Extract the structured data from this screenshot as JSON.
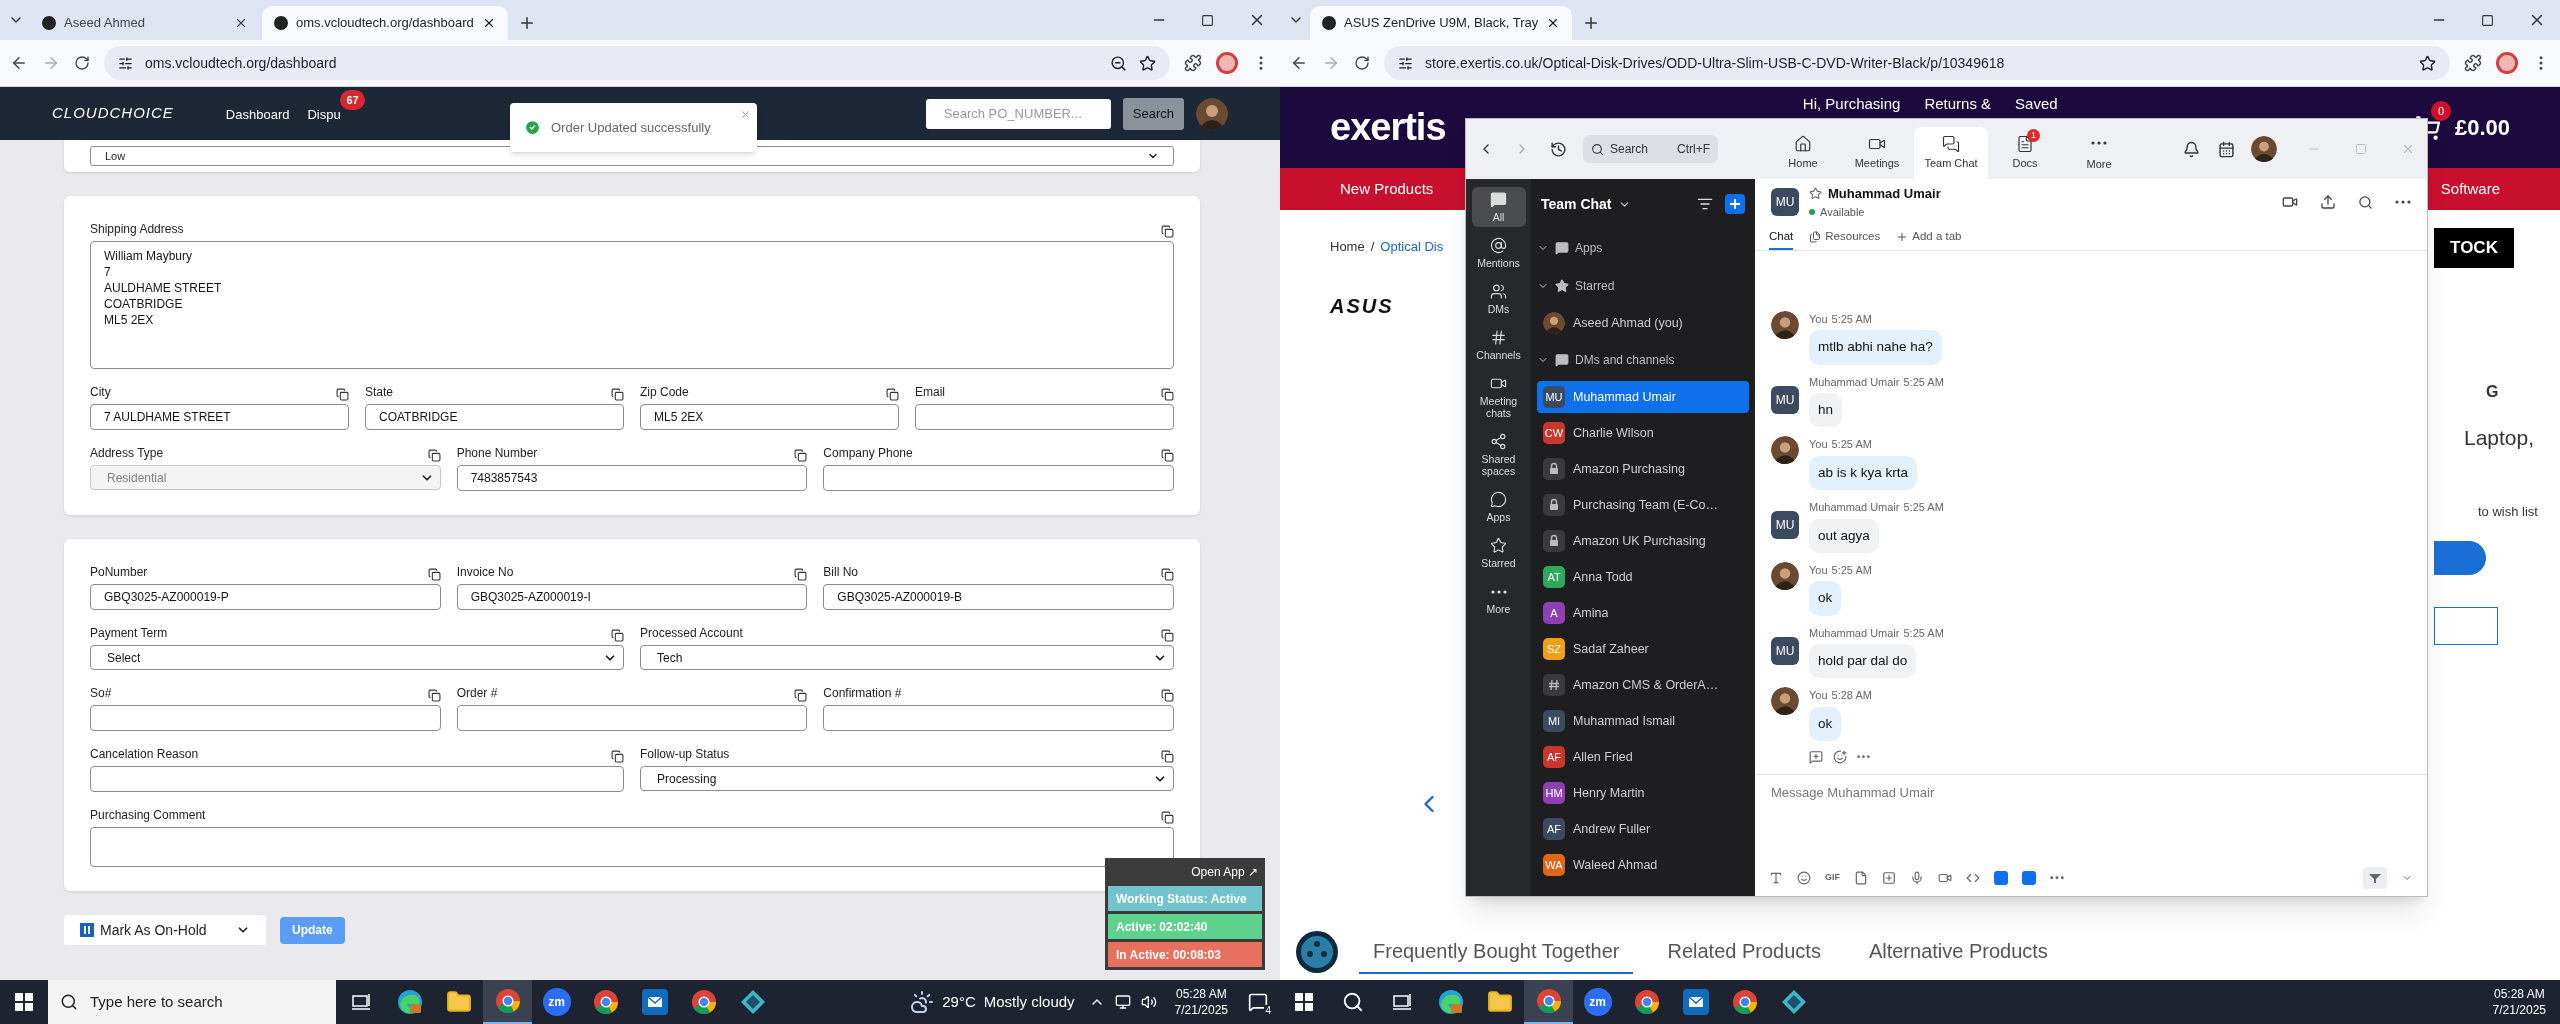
{
  "left_window": {
    "tabs": [
      {
        "title": "Aseed Ahmed",
        "selected": false
      },
      {
        "title": "oms.vcloudtech.org/dashboard",
        "selected": true
      }
    ],
    "url": "oms.vcloudtech.org/dashboard",
    "app": {
      "logo": "CLOUDCHOICE",
      "nav": [
        {
          "label": "Dashboard"
        },
        {
          "label": "Dispu",
          "badge": "67"
        }
      ],
      "search": {
        "placeholder": "Search PO_NUMBER...",
        "button": "Search"
      }
    },
    "toast": {
      "message": "Order Updated successfully"
    },
    "priority_select": {
      "value": "Low"
    },
    "cards": [
      {
        "rows": [
          [
            {
              "label": "Shipping Address",
              "kind": "textarea",
              "value": "William Maybury\n7\nAULDHAME STREET\nCOATBRIDGE\nML5 2EX",
              "disabled": false
            }
          ],
          [
            {
              "label": "City",
              "kind": "input",
              "value": "7 AULDHAME STREET",
              "disabled": false
            },
            {
              "label": "State",
              "kind": "input",
              "value": "COATBRIDGE",
              "disabled": false
            },
            {
              "label": "Zip Code",
              "kind": "input",
              "value": "ML5 2EX",
              "disabled": false
            },
            {
              "label": "Email",
              "kind": "input",
              "disabled": false
            }
          ],
          [
            {
              "label": "Address Type",
              "kind": "select",
              "value": "Residential",
              "disabled": true
            },
            {
              "label": "Phone Number",
              "kind": "input",
              "value": "7483857543",
              "disabled": false
            },
            {
              "label": "Company Phone",
              "kind": "input",
              "disabled": false
            }
          ]
        ]
      },
      {
        "rows": [
          [
            {
              "label": "PoNumber",
              "kind": "input",
              "value": "GBQ3025-AZ000019-P",
              "disabled": false
            },
            {
              "label": "Invoice No",
              "kind": "input",
              "value": "GBQ3025-AZ000019-I",
              "disabled": false
            },
            {
              "label": "Bill No",
              "kind": "input",
              "value": "GBQ3025-AZ000019-B",
              "disabled": false
            }
          ],
          [
            {
              "label": "Payment Term",
              "kind": "select",
              "value": "Select",
              "disabled": false
            },
            {
              "label": "Processed Account",
              "kind": "select",
              "value": "Tech",
              "disabled": false
            }
          ],
          [
            {
              "label": "So#",
              "kind": "input",
              "disabled": false
            },
            {
              "label": "Order #",
              "kind": "input",
              "disabled": false
            },
            {
              "label": "Confirmation #",
              "kind": "input",
              "disabled": false
            }
          ],
          [
            {
              "label": "Cancelation Reason",
              "kind": "input",
              "disabled": false
            },
            {
              "label": "Follow-up Status",
              "kind": "select",
              "value": "Processing",
              "disabled": false
            }
          ],
          [
            {
              "label": "Purchasing Comment",
              "kind": "textarea",
              "disabled": false
            }
          ]
        ]
      }
    ],
    "hold_select": {
      "value": "Mark As On-Hold"
    },
    "update_button": "Update",
    "status_widget": {
      "open_app": "Open App ↗",
      "statuses": [
        {
          "text": "Working Status: Active",
          "color": "#72c3cb"
        },
        {
          "text": "Active: 02:02:40",
          "color": "#5ed28c"
        },
        {
          "text": "In Active: 00:08:03",
          "color": "#e8705e"
        }
      ]
    },
    "taskbar": {
      "search_placeholder": "Type here to search",
      "apps": [
        {
          "kind": "task-view",
          "selected": false
        },
        {
          "kind": "edge",
          "selected": false
        },
        {
          "kind": "folder",
          "selected": false
        },
        {
          "kind": "chrome",
          "selected": true
        },
        {
          "kind": "zoom",
          "label": "zm",
          "selected": false
        },
        {
          "kind": "chrome",
          "selected": false
        },
        {
          "kind": "outlook",
          "selected": false
        },
        {
          "kind": "chrome",
          "selected": false
        },
        {
          "kind": "app",
          "selected": false
        }
      ],
      "weather": {
        "temp": "29°C",
        "text": "Mostly cloudy"
      },
      "time": "05:28 AM",
      "date": "7/21/2025",
      "notifications": "4"
    }
  },
  "right_window": {
    "tabs": [
      {
        "title": "ASUS ZenDrive U9M, Black, Tray",
        "selected": true
      }
    ],
    "url": "store.exertis.co.uk/Optical-Disk-Drives/ODD-Ultra-Slim-USB-C-DVD-Writer-Black/p/10349618",
    "site": {
      "logo": "exertis",
      "header_links": [
        "Hi, Purchasing",
        "Returns &",
        "Saved"
      ],
      "cart_count": "0",
      "cart_total": "£0.00",
      "nav": [
        "New Products",
        "Software"
      ],
      "breadcrumb": {
        "home": "Home",
        "separator": "/",
        "current": "Optical Dis"
      },
      "brand": "ASUS",
      "stock_button": "TOCK",
      "heading": "G",
      "subtitle": "Laptop,",
      "wishlist": "to wish list",
      "bottom_tabs": [
        {
          "label": "Frequently Bought Together",
          "selected": true
        },
        {
          "label": "Related Products",
          "selected": false
        },
        {
          "label": "Alternative Products",
          "selected": false
        }
      ]
    },
    "taskbar": {
      "apps": [
        {
          "kind": "search",
          "selected": false
        },
        {
          "kind": "task-view",
          "selected": false
        },
        {
          "kind": "edge",
          "selected": false
        },
        {
          "kind": "folder",
          "selected": false
        },
        {
          "kind": "chrome",
          "selected": true
        },
        {
          "kind": "zoom",
          "label": "zm",
          "selected": false
        },
        {
          "kind": "chrome",
          "selected": false
        },
        {
          "kind": "outlook",
          "selected": false
        },
        {
          "kind": "chrome",
          "selected": false
        },
        {
          "kind": "app",
          "selected": false
        }
      ],
      "time": "05:28 AM",
      "date": "7/21/2025"
    }
  },
  "zoom": {
    "search": {
      "placeholder": "Search",
      "shortcut": "Ctrl+F"
    },
    "nav": [
      {
        "label": "Home",
        "kind": "home",
        "selected": false
      },
      {
        "label": "Meetings",
        "kind": "meetings",
        "selected": false
      },
      {
        "label": "Team Chat",
        "kind": "chat",
        "selected": true
      },
      {
        "label": "Docs",
        "kind": "docs",
        "badge": "1",
        "selected": false
      },
      {
        "label": "More",
        "kind": "more",
        "selected": false
      }
    ],
    "rail": [
      {
        "label": "All",
        "kind": "all",
        "selected": true
      },
      {
        "label": "Mentions",
        "kind": "mentions",
        "selected": false
      },
      {
        "label": "DMs",
        "kind": "dms",
        "selected": false
      },
      {
        "label": "Channels",
        "kind": "channels",
        "selected": false
      },
      {
        "label": "Meeting chats",
        "kind": "meetings",
        "selected": false
      },
      {
        "label": "Shared spaces",
        "kind": "spaces",
        "selected": false
      },
      {
        "label": "Apps",
        "kind": "apps",
        "selected": false
      },
      {
        "label": "Starred",
        "kind": "starred",
        "selected": false
      },
      {
        "label": "More",
        "kind": "more",
        "selected": false
      }
    ],
    "list_title": "Team Chat",
    "list": [
      {
        "kind": "section",
        "label": "Apps",
        "expanded": true
      },
      {
        "kind": "starred-section",
        "label": "Starred",
        "expanded": true
      },
      {
        "kind": "photo",
        "name": "Aseed Ahmad (you)",
        "selected": false
      },
      {
        "kind": "section",
        "label": "DMs and channels",
        "expanded": true
      },
      {
        "kind": "initials",
        "name": "Muhammad Umair",
        "initials": "MU",
        "color": "#3b4a5e",
        "selected": true
      },
      {
        "kind": "initials",
        "name": "Charlie Wilson",
        "initials": "CW",
        "color": "#c9362b",
        "selected": false
      },
      {
        "kind": "lock",
        "name": "Amazon Purchasing",
        "selected": false
      },
      {
        "kind": "lock",
        "name": "Purchasing Team (E-Co…",
        "selected": false
      },
      {
        "kind": "lock",
        "name": "Amazon UK Purchasing",
        "selected": false
      },
      {
        "kind": "initials",
        "name": "Anna Todd",
        "initials": "AT",
        "color": "#2ea85a",
        "selected": false
      },
      {
        "kind": "initials",
        "name": "Amina",
        "initials": "A",
        "color": "#8e3fb0",
        "selected": false
      },
      {
        "kind": "initials",
        "name": "Sadaf Zaheer",
        "initials": "SZ",
        "color": "#f0a018",
        "selected": false
      },
      {
        "kind": "hash",
        "name": "Amazon CMS & OrderA…",
        "selected": false
      },
      {
        "kind": "initials",
        "name": "Muhammad Ismail",
        "initials": "MI",
        "color": "#3b4a5e",
        "selected": false
      },
      {
        "kind": "initials",
        "name": "Allen Fried",
        "initials": "AF",
        "color": "#c9362b",
        "selected": false
      },
      {
        "kind": "initials",
        "name": "Henry Martin",
        "initials": "HM",
        "color": "#8e3fb0",
        "selected": false
      },
      {
        "kind": "initials",
        "name": "Andrew Fuller",
        "initials": "AF",
        "color": "#3b4a5e",
        "selected": false
      },
      {
        "kind": "initials",
        "name": "Waleed Ahmad",
        "initials": "WA",
        "color": "#e0661a",
        "selected": false
      }
    ],
    "chat": {
      "contact": {
        "initials": "MU",
        "name": "Muhammad Umair",
        "status": "Available"
      },
      "tabs": [
        {
          "label": "Chat",
          "selected": true
        },
        {
          "label": "Resources",
          "selected": false
        },
        {
          "label": "Add a tab",
          "selected": false
        }
      ],
      "messages": [
        {
          "sender": "You",
          "time": "5:25 AM",
          "text": "mtlb abhi nahe ha?",
          "mine": true
        },
        {
          "sender": "Muhammad Umair",
          "time": "5:25 AM",
          "text": "hn",
          "mine": false,
          "initials": "MU"
        },
        {
          "sender": "You",
          "time": "5:25 AM",
          "text": "ab is k kya krta",
          "mine": true
        },
        {
          "sender": "Muhammad Umair",
          "time": "5:25 AM",
          "text": "out agya",
          "mine": false,
          "initials": "MU"
        },
        {
          "sender": "You",
          "time": "5:25 AM",
          "text": "ok",
          "mine": true
        },
        {
          "sender": "Muhammad Umair",
          "time": "5:25 AM",
          "text": "hold par dal do",
          "mine": false,
          "initials": "MU"
        },
        {
          "sender": "You",
          "time": "5:28 AM",
          "text": "ok",
          "mine": true
        }
      ],
      "composer": {
        "placeholder": "Message Muhammad Umair",
        "gif": "GIF"
      }
    }
  }
}
